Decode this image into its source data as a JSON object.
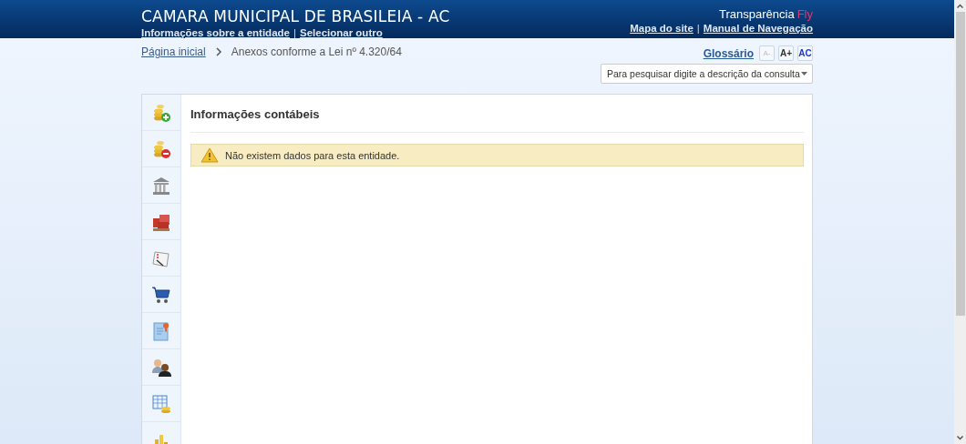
{
  "header": {
    "title": "CAMARA MUNICIPAL DE BRASILEIA - AC",
    "links": [
      "Informações sobre a entidade",
      "Selecionar outro"
    ],
    "brand": "Transparência",
    "brand_accent": "Fly",
    "nav_links": [
      "Mapa do site",
      "Manual de Navegação"
    ],
    "separator": "|"
  },
  "breadcrumb": {
    "home": "Página inicial",
    "current": "Anexos conforme a Lei nº 4.320/64"
  },
  "glossary": "Glossário",
  "font_buttons": [
    {
      "label": "A-",
      "disabled": true
    },
    {
      "label": "A+",
      "disabled": false
    },
    {
      "label": "AC",
      "disabled": false
    }
  ],
  "search": {
    "placeholder": "Para pesquisar digite a descrição da consulta"
  },
  "content": {
    "title": "Informações contábeis",
    "alert": "Não existem dados para esta entidade."
  }
}
